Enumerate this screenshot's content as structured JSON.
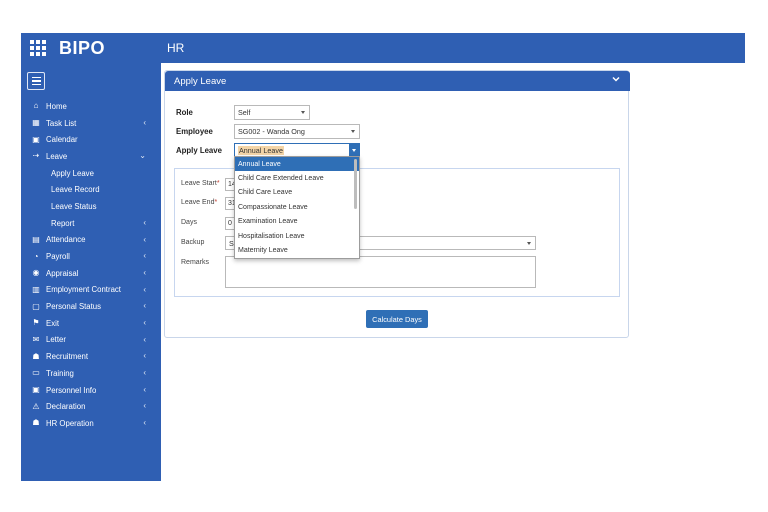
{
  "brand": {
    "logo": "BIPO"
  },
  "topbar": {
    "title": "HR"
  },
  "sidebar": {
    "items": [
      {
        "label": "Home",
        "icon": "home-icon",
        "chevron": ""
      },
      {
        "label": "Task List",
        "icon": "task-list-icon",
        "chevron": "‹"
      },
      {
        "label": "Calendar",
        "icon": "calendar-icon",
        "chevron": ""
      },
      {
        "label": "Leave",
        "icon": "leave-icon",
        "chevron": "⌄"
      },
      {
        "label": "Apply Leave",
        "sub": true,
        "chevron": ""
      },
      {
        "label": "Leave Record",
        "sub": true,
        "chevron": ""
      },
      {
        "label": "Leave Status",
        "sub": true,
        "chevron": ""
      },
      {
        "label": "Report",
        "sub": true,
        "chevron": "‹"
      },
      {
        "label": "Attendance",
        "icon": "attendance-icon",
        "chevron": "‹"
      },
      {
        "label": "Payroll",
        "icon": "payroll-icon",
        "chevron": "‹"
      },
      {
        "label": "Appraisal",
        "icon": "appraisal-icon",
        "chevron": "‹"
      },
      {
        "label": "Employment Contract",
        "icon": "contract-icon",
        "chevron": "‹"
      },
      {
        "label": "Personal Status",
        "icon": "personal-status-icon",
        "chevron": "‹"
      },
      {
        "label": "Exit",
        "icon": "exit-icon",
        "chevron": "‹"
      },
      {
        "label": "Letter",
        "icon": "letter-icon",
        "chevron": "‹"
      },
      {
        "label": "Recruitment",
        "icon": "recruitment-icon",
        "chevron": "‹"
      },
      {
        "label": "Training",
        "icon": "training-icon",
        "chevron": "‹"
      },
      {
        "label": "Personnel Info",
        "icon": "personnel-info-icon",
        "chevron": "‹"
      },
      {
        "label": "Declaration",
        "icon": "declaration-icon",
        "chevron": "‹"
      },
      {
        "label": "HR Operation",
        "icon": "hr-operation-icon",
        "chevron": "‹"
      }
    ]
  },
  "card": {
    "title": "Apply Leave",
    "role_label": "Role",
    "role_value": "Self",
    "employee_label": "Employee",
    "employee_value": "SG002 - Wanda Ong",
    "apply_leave_label": "Apply Leave",
    "apply_leave_value": "Annual Leave",
    "leave_start_label": "Leave Start",
    "leave_start_value": "14",
    "leave_end_label": "Leave End",
    "leave_end_value": "31",
    "days_label": "Days",
    "days_value": "0",
    "backup_label": "Backup",
    "backup_value": "SG",
    "remarks_label": "Remarks",
    "required_mark": "*",
    "calculate_button": "Calculate Days"
  },
  "dropdown": {
    "options": [
      "Annual Leave",
      "Child Care Extended Leave",
      "Child Care Leave",
      "Compassionate Leave",
      "Examination Leave",
      "Hospitalisation Leave",
      "Maternity Leave"
    ],
    "highlighted": 0
  },
  "colors": {
    "primary": "#2f5fb3",
    "button": "#2f6fb6",
    "border": "#c7d6ef"
  }
}
